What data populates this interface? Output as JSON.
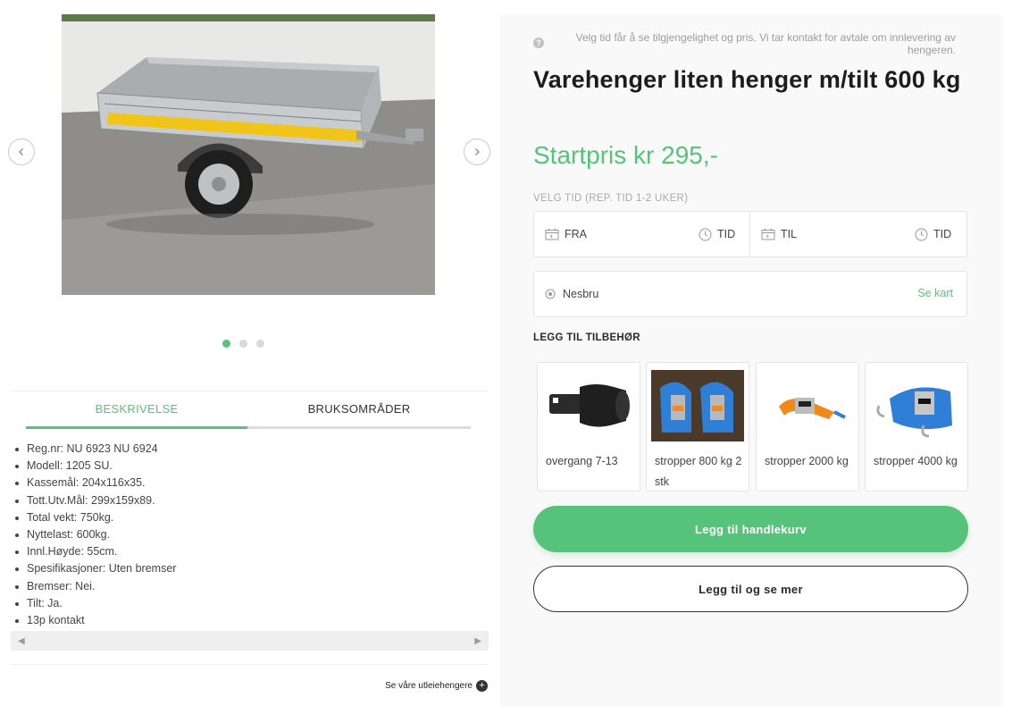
{
  "gallery": {
    "image_subject": "trailer-photo",
    "dots": 3,
    "active_dot": 0
  },
  "tabs": [
    {
      "label": "BESKRIVELSE",
      "active": true
    },
    {
      "label": "BRUKSOMRÅDER",
      "active": false
    }
  ],
  "specs": [
    "Reg.nr: NU 6923 NU 6924",
    "Modell: 1205 SU.",
    "Kassemål: 204x116x35.",
    "Tott.Utv.Mål: 299x159x89.",
    "Total vekt: 750kg.",
    "Nyttelast: 600kg.",
    "Innl.Høyde: 55cm.",
    "Spesifikasjoner: Uten bremser",
    "Bremser: Nei.",
    "Tilt: Ja.",
    "13p kontakt"
  ],
  "see_link": "Se våre utleiehengere",
  "product": {
    "info_text": "Velg tid får å se tilgjengelighet og pris. Vi tar kontakt for avtale om innlevering av hengeren.",
    "title": "Varehenger liten henger m/tilt 600 kg",
    "price": "Startpris kr 295,-"
  },
  "booking": {
    "time_label": "VELG TID (REP. TID 1-2 UKER)",
    "from_label": "FRA",
    "from_time_label": "TID",
    "to_label": "TIL",
    "to_time_label": "TID",
    "location": "Nesbru",
    "map_link": "Se kart"
  },
  "accessories": {
    "title": "LEGG TIL TILBEHØR",
    "items": [
      {
        "label": "overgang 7-13",
        "icon": "adapter-image"
      },
      {
        "label": "stropper 800 kg 2 stk",
        "icon": "blue-straps-image"
      },
      {
        "label": "stropper 2000 kg",
        "icon": "orange-strap-image"
      },
      {
        "label": "stropper 4000 kg",
        "icon": "blue-strap-hooks-image"
      }
    ]
  },
  "buttons": {
    "add_to_cart": "Legg til handlekurv",
    "add_and_more": "Legg til og se mer"
  },
  "colors": {
    "accent": "#55c47a",
    "text_dark": "#1c1c1c",
    "muted": "#9d9d9d",
    "panel_bg": "#f9f9f9"
  }
}
